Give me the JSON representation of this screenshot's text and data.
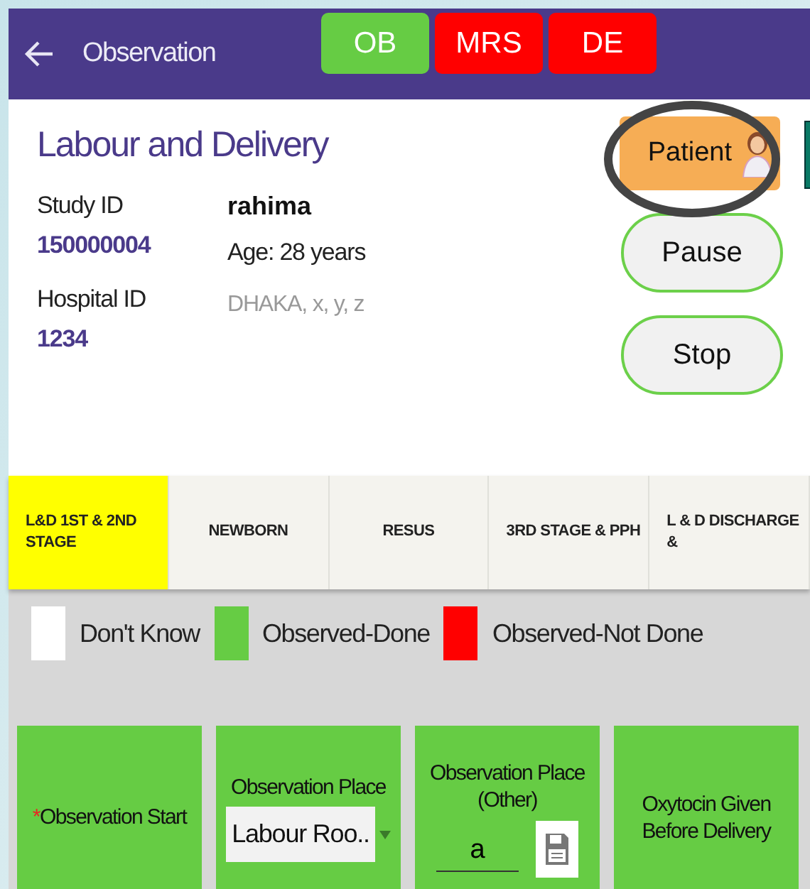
{
  "header": {
    "title": "Observation",
    "badges": [
      {
        "label": "OB",
        "color": "#66cc44"
      },
      {
        "label": "MRS",
        "color": "#ff0000"
      },
      {
        "label": "DE",
        "color": "#ff0000"
      }
    ]
  },
  "section_title": "Labour and Delivery",
  "patient": {
    "study_id_label": "Study ID",
    "study_id": "150000004",
    "hospital_id_label": "Hospital ID",
    "hospital_id": "1234",
    "name": "rahima",
    "age": "Age: 28 years",
    "address": "DHAKA, x, y, z"
  },
  "patient_button": {
    "label": "Patient",
    "highlighted": true
  },
  "buttons": [
    "Pause",
    "Stop"
  ],
  "tabs": [
    {
      "label": "L&D 1ST & 2ND STAGE",
      "selected": true
    },
    {
      "label": "NEWBORN",
      "selected": false
    },
    {
      "label": "RESUS",
      "selected": false
    },
    {
      "label": "3RD STAGE & PPH",
      "selected": false
    },
    {
      "label": "L & D DISCHARGE &",
      "selected": false
    }
  ],
  "legend": [
    {
      "label": "Don't Know",
      "color": "#ffffff"
    },
    {
      "label": "Observed-Done",
      "color": "#66cc44"
    },
    {
      "label": "Observed-Not Done",
      "color": "#ff0000"
    }
  ],
  "cards": [
    {
      "kind": "plain",
      "label": "Observation Start",
      "required_mark": "*",
      "color": "#66cc44"
    },
    {
      "kind": "dropdown",
      "label": "Observation Place",
      "value": "Labour Roo..",
      "color": "#66cc44"
    },
    {
      "kind": "text",
      "label": "Observation Place (Other)",
      "value": "a",
      "color": "#66cc44"
    },
    {
      "kind": "plain",
      "label": "Oxytocin Given Before Delivery",
      "color": "#66cc44"
    }
  ]
}
